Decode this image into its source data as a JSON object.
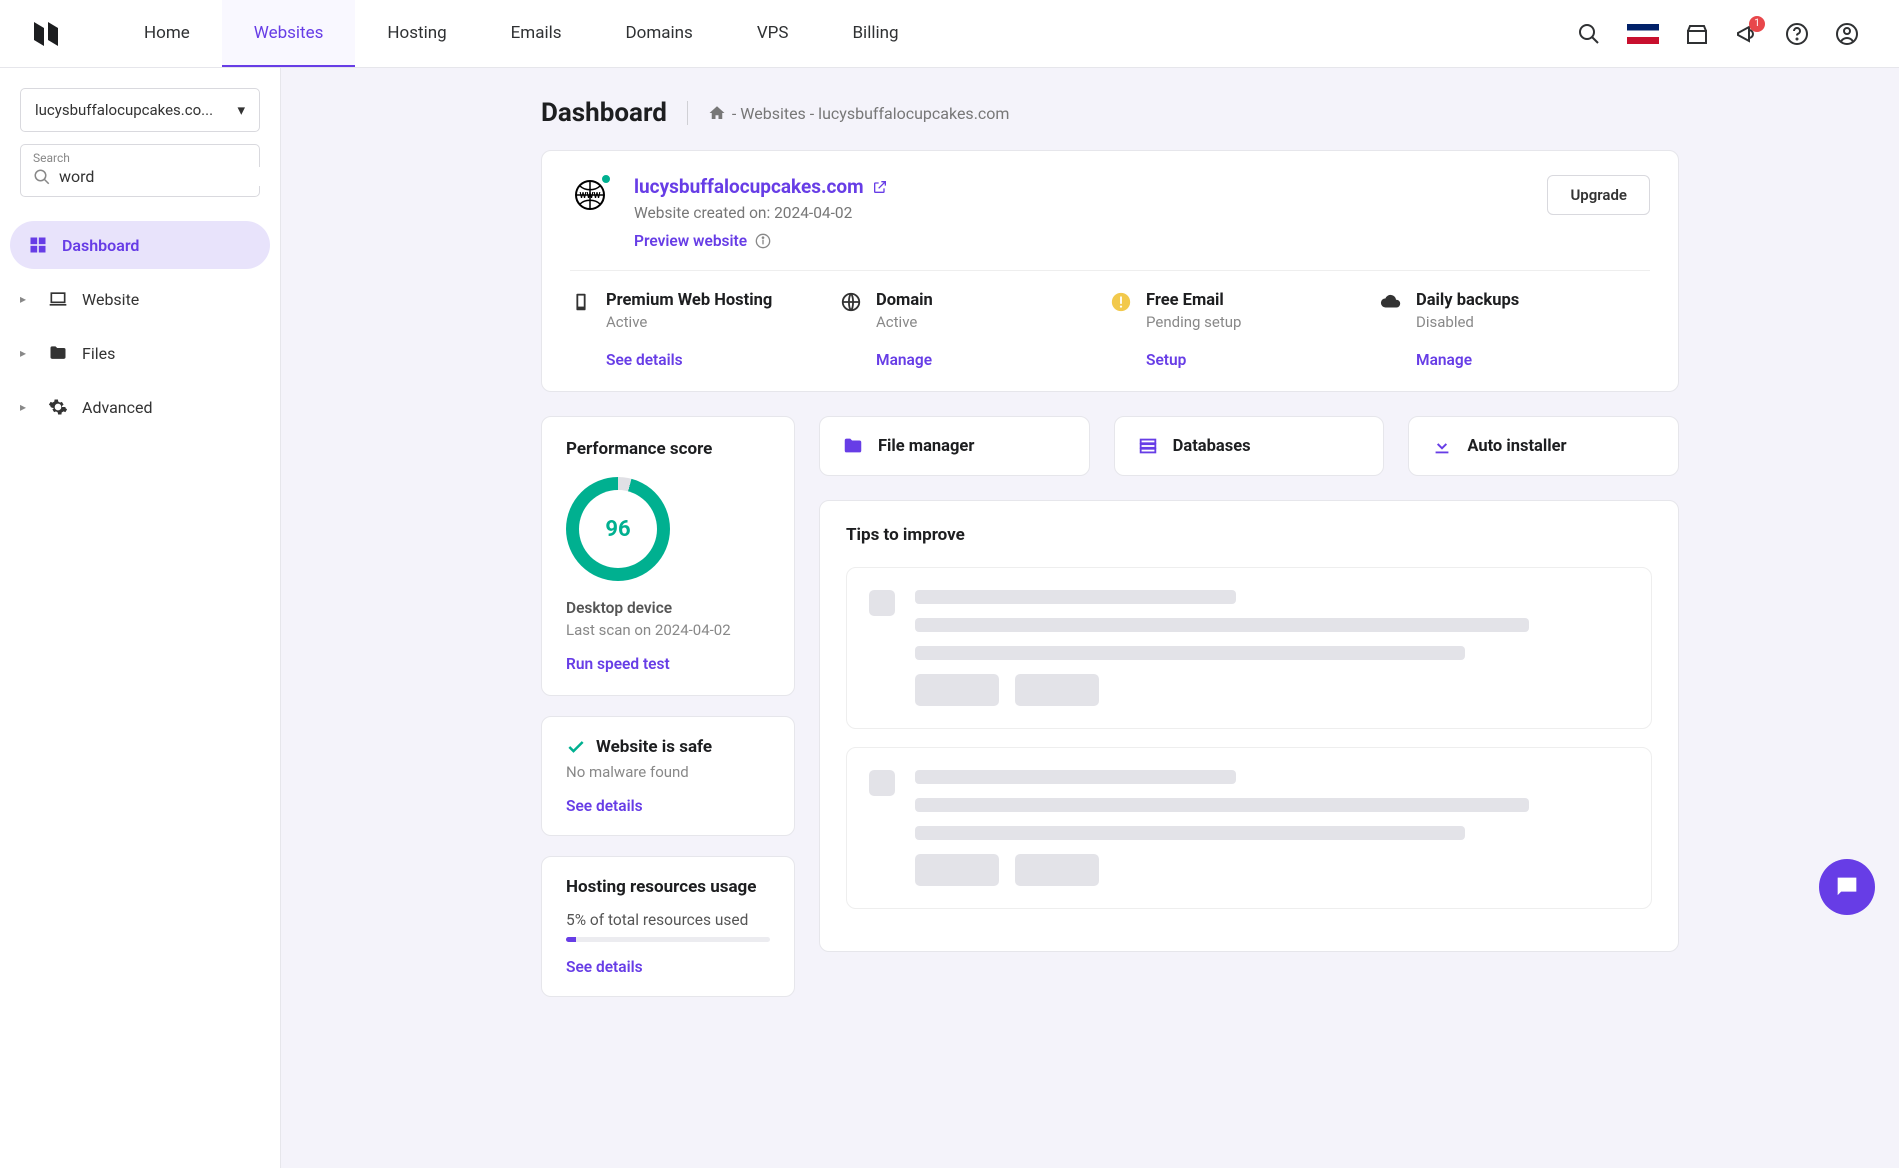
{
  "nav": {
    "items": [
      "Home",
      "Websites",
      "Hosting",
      "Emails",
      "Domains",
      "VPS",
      "Billing"
    ],
    "active_index": 1,
    "notification_count": "1"
  },
  "sidebar": {
    "domain_selected": "lucysbuffalocupcakes.co...",
    "search_label": "Search",
    "search_value": "word",
    "items": [
      {
        "label": "Dashboard",
        "icon": "dashboard"
      },
      {
        "label": "Website",
        "icon": "laptop"
      },
      {
        "label": "Files",
        "icon": "folder"
      },
      {
        "label": "Advanced",
        "icon": "gear"
      }
    ]
  },
  "breadcrumb": {
    "title": "Dashboard",
    "path": "- Websites - lucysbuffalocupcakes.com"
  },
  "site": {
    "name": "lucysbuffalocupcakes.com",
    "created": "Website created on: 2024-04-02",
    "preview": "Preview website",
    "upgrade": "Upgrade"
  },
  "status": [
    {
      "title": "Premium Web Hosting",
      "sub": "Active",
      "link": "See details",
      "icon": "device"
    },
    {
      "title": "Domain",
      "sub": "Active",
      "link": "Manage",
      "icon": "globe"
    },
    {
      "title": "Free Email",
      "sub": "Pending setup",
      "link": "Setup",
      "icon": "warn"
    },
    {
      "title": "Daily backups",
      "sub": "Disabled",
      "link": "Manage",
      "icon": "cloud"
    }
  ],
  "performance": {
    "title": "Performance score",
    "score": "96",
    "device": "Desktop device",
    "last_scan": "Last scan on 2024-04-02",
    "link": "Run speed test"
  },
  "safety": {
    "title": "Website is safe",
    "sub": "No malware found",
    "link": "See details"
  },
  "resources": {
    "title": "Hosting resources usage",
    "text": "5% of total resources used",
    "percent": 5,
    "link": "See details"
  },
  "tools": [
    {
      "label": "File manager",
      "icon": "folder"
    },
    {
      "label": "Databases",
      "icon": "database"
    },
    {
      "label": "Auto installer",
      "icon": "download"
    }
  ],
  "tips": {
    "title": "Tips to improve"
  }
}
